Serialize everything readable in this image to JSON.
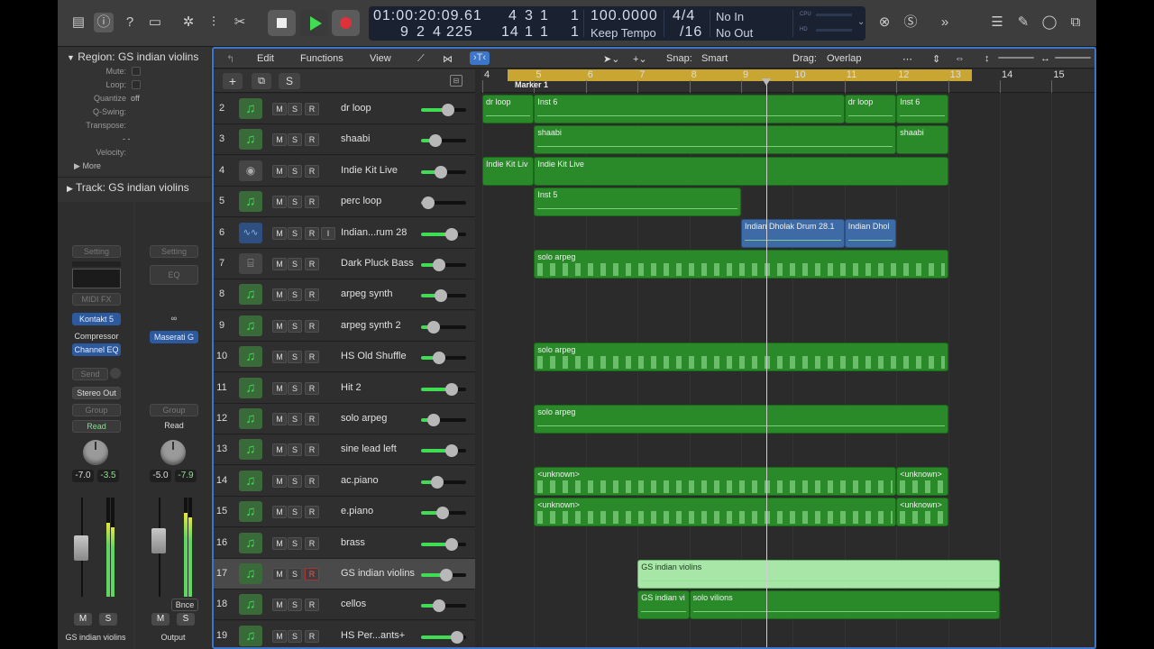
{
  "transport": {
    "time": "01:00:20:09.61",
    "bars_row1": [
      "4",
      "3",
      "1"
    ],
    "bars_row1_last": "1",
    "bars_row2": [
      "9",
      "2",
      "4",
      "225"
    ],
    "bars_row2_b": [
      "14",
      "1",
      "1"
    ],
    "bars_row2_last": "1",
    "tempo": "100.0000",
    "tempo_label": "Keep Tempo",
    "signature": "4/4",
    "division": "/16",
    "in": "No In",
    "out": "No Out",
    "cpu_label": "CPU",
    "hd_label": "HD"
  },
  "inspector": {
    "region_title": "Region: GS indian violins",
    "mute": "Mute:",
    "loop": "Loop:",
    "quantize": "Quantize",
    "quantize_val": "off",
    "qswing": "Q-Swing:",
    "transpose": "Transpose:",
    "transpose_val": "-  -",
    "velocity": "Velocity:",
    "more": "More",
    "track_title": "Track:  GS indian violins"
  },
  "strip1": {
    "setting": "Setting",
    "midifx": "MIDI FX",
    "plugin": "Kontakt 5",
    "fx1": "Compressor",
    "fx2": "Channel EQ",
    "send": "Send",
    "out": "Stereo Out",
    "group": "Group",
    "read": "Read",
    "pan_a": "-7.0",
    "pan_b": "-3.5",
    "mute": "M",
    "solo": "S",
    "name": "GS indian violins"
  },
  "strip2": {
    "setting": "Setting",
    "eq": "EQ",
    "link": "∞",
    "plugin": "Maserati G",
    "group": "Group",
    "read": "Read",
    "pan_a": "-5.0",
    "pan_b": "-7.9",
    "bnce": "Bnce",
    "mute": "M",
    "solo": "S",
    "name": "Output"
  },
  "menu": {
    "edit": "Edit",
    "functions": "Functions",
    "view": "View",
    "snap_label": "Snap:",
    "snap_val": "Smart",
    "drag_label": "Drag:",
    "drag_val": "Overlap"
  },
  "ruler": {
    "bars": [
      "4",
      "5",
      "6",
      "7",
      "8",
      "9",
      "10",
      "11",
      "12",
      "13",
      "14",
      "15"
    ],
    "marker": "Marker 1"
  },
  "tracks": [
    {
      "num": "2",
      "name": "dr loop",
      "icon": "midi"
    },
    {
      "num": "3",
      "name": "shaabi",
      "icon": "midi"
    },
    {
      "num": "4",
      "name": "Indie Kit Live",
      "icon": "drum"
    },
    {
      "num": "5",
      "name": "perc loop",
      "icon": "midi"
    },
    {
      "num": "6",
      "name": "Indian...rum 28",
      "icon": "audio"
    },
    {
      "num": "7",
      "name": "Dark Pluck Bass",
      "icon": "synth"
    },
    {
      "num": "8",
      "name": "arpeg synth",
      "icon": "midi"
    },
    {
      "num": "9",
      "name": "arpeg synth 2",
      "icon": "midi"
    },
    {
      "num": "10",
      "name": "HS Old Shuffle",
      "icon": "midi"
    },
    {
      "num": "11",
      "name": "Hit 2",
      "icon": "midi"
    },
    {
      "num": "12",
      "name": "solo arpeg",
      "icon": "midi"
    },
    {
      "num": "13",
      "name": "sine lead left",
      "icon": "midi"
    },
    {
      "num": "14",
      "name": "ac.piano",
      "icon": "midi"
    },
    {
      "num": "15",
      "name": "e.piano",
      "icon": "midi"
    },
    {
      "num": "16",
      "name": "brass",
      "icon": "midi"
    },
    {
      "num": "17",
      "name": "GS indian violins",
      "icon": "midi"
    },
    {
      "num": "18",
      "name": "cellos",
      "icon": "midi"
    },
    {
      "num": "19",
      "name": "HS Per...ants+",
      "icon": "midi"
    }
  ],
  "track_buttons": {
    "m": "M",
    "s": "S",
    "r": "R",
    "i": "I"
  },
  "regions": {
    "r2a": "dr loop",
    "r2b": "Inst 6",
    "r2c": "dr loop",
    "r2d": "Inst 6",
    "r3a": "shaabi",
    "r3b": "shaabi",
    "r4a": "Indie Kit Liv",
    "r4b": "Indie Kit Live",
    "r5a": "Inst 5",
    "r6a": "Indian Dholak Drum 28.1",
    "r6b": "Indian Dhol",
    "r7a": "solo arpeg",
    "r10a": "solo arpeg",
    "r12a": "solo arpeg",
    "r14a": "<unknown>",
    "r14b": "<unknown>",
    "r15a": "<unknown>",
    "r15b": "<unknown>",
    "r17a": "GS indian violins",
    "r18a": "GS indian vi",
    "r18b": "solo vilions"
  },
  "colors": {
    "region_green": "#2a8a2a",
    "accent_blue": "#3b76c9",
    "cycle": "#c9a631"
  }
}
